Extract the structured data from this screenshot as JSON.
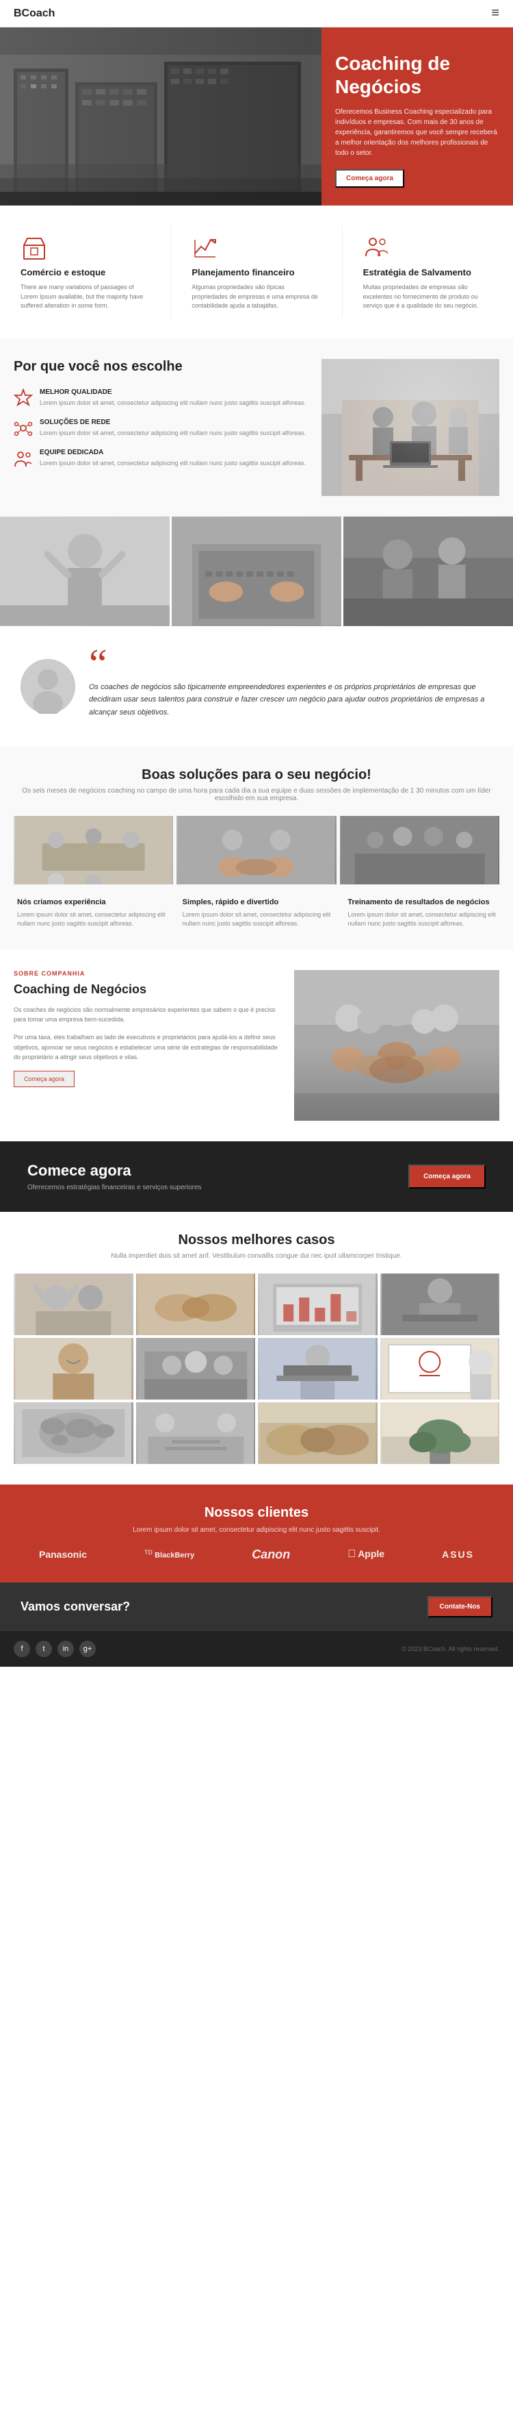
{
  "header": {
    "logo": "BCoach",
    "menu_icon": "≡"
  },
  "hero": {
    "title": "Coaching de Negócios",
    "description": "Oferecemos Business Coaching especializado para indivíduos e empresas. Com mais de 30 anos de experiência, garantiremos que você sempre receberá a melhor orientação dos melhores profissionais de todo o setor.",
    "button_label": "Começa agora"
  },
  "services": [
    {
      "icon": "shop",
      "title": "Comércio e estoque",
      "description": "There are many variations of passages of Lorem Ipsum available, but the majority have suffered alteration in some form."
    },
    {
      "icon": "chart",
      "title": "Planejamento financeiro",
      "description": "Algumas propriedades são típicas propriedades de empresas e uma empresa de contabilidade ajuda a tabajáfas."
    },
    {
      "icon": "people",
      "title": "Estratégia de Salvamento",
      "description": "Muitas propriedades de empresas são excelentes no fornecimento de produto ou serviço que é a qualidade do seu negócio."
    }
  ],
  "why": {
    "title": "Por que você nos escolhe",
    "items": [
      {
        "title": "MELHOR QUALIDADE",
        "description": "Lorem ipsum dolor sit amet, consectetur adipiscing elit nullam nunc justo sagittis suscipit alforeas."
      },
      {
        "title": "SOLUÇÕES DE REDE",
        "description": "Lorem ipsum dolor sit amet, consectetur adipiscing elit nullam nunc justo sagittis suscipit alforeas."
      },
      {
        "title": "EQUIPE DEDICADA",
        "description": "Lorem ipsum dolor sit amet, consectetur adipiscing elit nullam nunc justo sagittis suscipit alforeas."
      }
    ]
  },
  "quote": {
    "mark": "“",
    "text": "Os coaches de negócios são tipicamente empreendedores experientes e os próprios proprietários de empresas que decidiram usar seus talentos para construir e fazer crescer um negócio para ajudar outros proprietários de empresas a alcançar seus objetivos."
  },
  "solutions": {
    "title": "Boas soluções para o seu negócio!",
    "subtitle": "Os seis meses de negócios coaching no campo de uma hora para cada dia a sua equipe e duas sessões de implementação de 1 30 minutos com um líder escolhido em sua empresa.",
    "cards": [
      {
        "title": "Nós criamos experiência",
        "description": "Lorem ipsum dolor sit amet, consectetur adipiscing elit nullam nunc justo sagittis suscipit alforeas."
      },
      {
        "title": "Simples, rápido e divertido",
        "description": "Lorem ipsum dolor sit amet, consectetur adipiscing elit nullam nunc justo sagittis suscipit alforeas."
      },
      {
        "title": "Treinamento de resultados de negócios",
        "description": "Lorem ipsum dolor sit amet, consectetur adipiscing elit nullam nunc justo sagittis suscipit alforeas."
      }
    ]
  },
  "about": {
    "tag": "SOBRE COMPANHIA",
    "title": "Coaching de Negócios",
    "description1": "Os coaches de negócios são normalmente empresários experientes que sabem o que é preciso para tomar uma empresa bem-sucedida.",
    "description2": "Por uma taxa, eles trabalham ao lado de executivos e proprietários para ajudá-los a definir seus objetivos, ajomoar se seus negócios e estabelecer uma série de estratégias de responsabilidade do proprietário a atingir seus objetivos e vilas.",
    "button_label": "Começa agora"
  },
  "cta": {
    "title": "Comece agora",
    "description": "Oferecemos estratégias financeiras e serviços superiores",
    "button_label": "Começa agora"
  },
  "cases": {
    "title": "Nossos melhores casos",
    "subtitle": "Nulla imperdiet duis sit amet arif. Vestibulum convallis congue dui nec ipuit ullamcorper tristique."
  },
  "clients": {
    "title": "Nossos clientes",
    "description": "Lorem ipsum dolor sit amet, consectetur adipiscing elit nunc justo sagittis suscipit.",
    "logos": [
      {
        "name": "Panasonic",
        "text": "Panasonic"
      },
      {
        "name": "BlackBerry",
        "text": "BlackBerry"
      },
      {
        "name": "Canon",
        "text": "Canon"
      },
      {
        "name": "Apple",
        "text": "Apple"
      },
      {
        "name": "Asus",
        "text": "ASUS"
      }
    ]
  },
  "contact_footer": {
    "title": "Vamos conversar?",
    "button_label": "Contate-Nos"
  },
  "footer": {
    "copyright": "© 2023 BCoach. All rights reserved.",
    "socials": [
      "f",
      "t",
      "in",
      "g+"
    ]
  }
}
